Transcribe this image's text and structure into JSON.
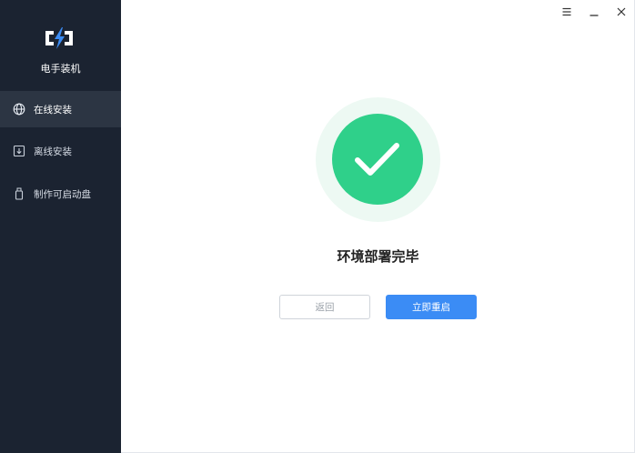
{
  "app": {
    "name": "电手装机",
    "accent_color": "#3b8cf5",
    "sidebar_bg": "#1b2331",
    "success_color": "#2fd08a"
  },
  "sidebar": {
    "items": [
      {
        "label": "在线安装",
        "icon": "globe-icon",
        "active": true
      },
      {
        "label": "离线安装",
        "icon": "download-box-icon",
        "active": false
      },
      {
        "label": "制作可启动盘",
        "icon": "usb-drive-icon",
        "active": false
      }
    ]
  },
  "window_controls": {
    "menu_icon": "menu-icon",
    "minimize_icon": "minimize-icon",
    "close_icon": "close-icon"
  },
  "main": {
    "status_icon": "check-icon",
    "title": "环境部署完毕",
    "back_label": "返回",
    "restart_label": "立即重启"
  }
}
